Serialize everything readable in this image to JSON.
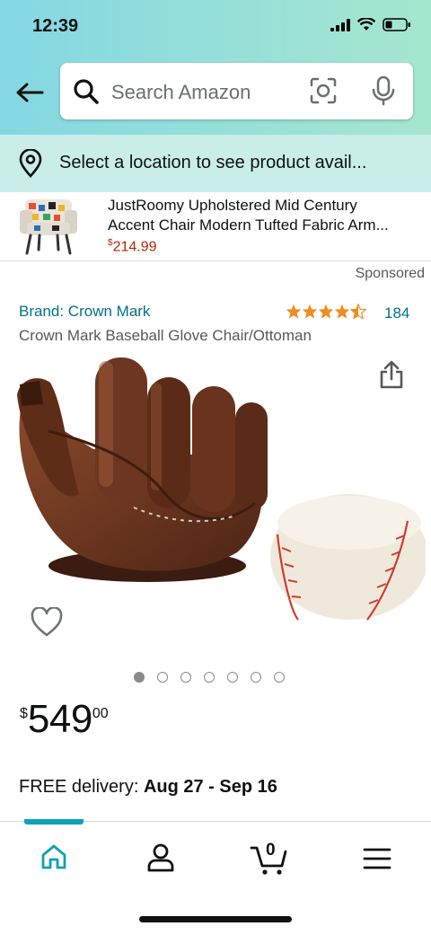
{
  "status": {
    "time": "12:39"
  },
  "search": {
    "placeholder": "Search Amazon"
  },
  "location": {
    "text": "Select a location to see product avail..."
  },
  "ad": {
    "title_line1": "JustRoomy Upholstered Mid Century",
    "title_line2": "Accent Chair Modern Tufted Fabric Arm...",
    "price_symbol": "$",
    "price": "214.99"
  },
  "sponsored": "Sponsored",
  "product": {
    "brand": "Brand: Crown Mark",
    "rating": 4.5,
    "reviews": "184",
    "title": "Crown Mark Baseball Glove Chair/Ottoman",
    "image_count": 7,
    "current_image": 1,
    "price_symbol": "$",
    "price_whole": "549",
    "price_fraction": "00"
  },
  "delivery": {
    "label": "FREE delivery: ",
    "dates": "Aug 27 - Sep 16"
  },
  "nav": {
    "items": [
      "home-icon",
      "account-icon",
      "cart-icon",
      "menu-icon"
    ],
    "cart_count": "0"
  },
  "colors": {
    "accent": "#007185",
    "price_red": "#b12704",
    "star": "#f08d1d",
    "nav_active": "#11a0b6"
  }
}
